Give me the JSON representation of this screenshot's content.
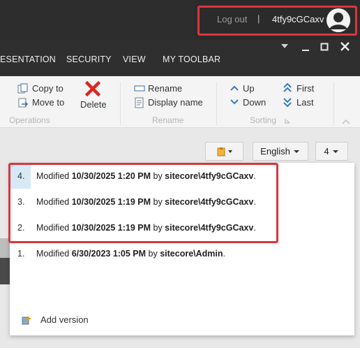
{
  "header": {
    "logout_label": "Log out",
    "separator": "|",
    "username": "4tfy9cGCaxv"
  },
  "ribbon": {
    "tabs": [
      "ESENTATION",
      "SECURITY",
      "VIEW",
      "MY TOOLBAR"
    ],
    "operations": {
      "copy_to": "Copy to",
      "move_to": "Move to",
      "delete": "Delete",
      "group_label": "Operations"
    },
    "rename": {
      "rename": "Rename",
      "display_name": "Display name",
      "group_label": "Rename"
    },
    "sorting": {
      "up": "Up",
      "down": "Down",
      "first": "First",
      "last": "Last",
      "group_label": "Sorting"
    }
  },
  "toolbar": {
    "language": "English",
    "version": "4"
  },
  "versions": [
    {
      "number": "4.",
      "prefix": "Modified ",
      "date": "10/30/2025 1:20 PM",
      "by": " by ",
      "user": "sitecore\\4tfy9cGCaxv",
      "suffix": "."
    },
    {
      "number": "3.",
      "prefix": "Modified ",
      "date": "10/30/2025 1:19 PM",
      "by": " by ",
      "user": "sitecore\\4tfy9cGCaxv",
      "suffix": "."
    },
    {
      "number": "2.",
      "prefix": "Modified ",
      "date": "10/30/2025 1:19 PM",
      "by": " by ",
      "user": "sitecore\\4tfy9cGCaxv",
      "suffix": "."
    },
    {
      "number": "1.",
      "prefix": "Modified ",
      "date": "6/30/2023 1:05 PM",
      "by": " by ",
      "user": "sitecore\\Admin",
      "suffix": "."
    }
  ],
  "add_version_label": "Add version",
  "colors": {
    "highlight": "#d9363e",
    "topbar": "#2b2b2b",
    "selected_row": "#d6e9f7"
  }
}
